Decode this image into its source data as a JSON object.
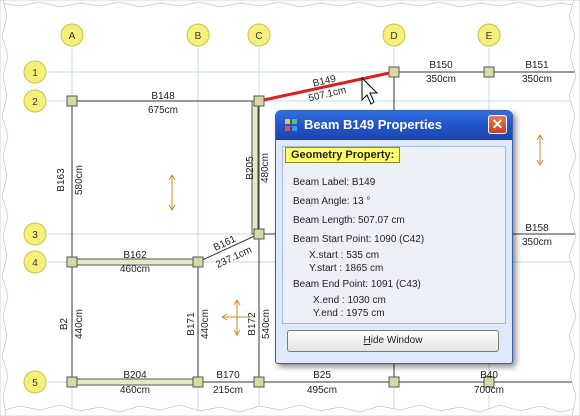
{
  "grid": {
    "columns": [
      "A",
      "B",
      "C",
      "D",
      "E"
    ],
    "rows": [
      "1",
      "2",
      "3",
      "4",
      "5"
    ]
  },
  "plan_labels": {
    "b148": "B148",
    "b148_len": "675cm",
    "b149": "B149",
    "b149_len": "507.1cm",
    "b150": "B150",
    "b150_len": "350cm",
    "b151": "B151",
    "b151_len": "350cm",
    "b163": "B163",
    "b163_len": "580cm",
    "b205": "B205",
    "b205_len": "480cm",
    "b158": "B158",
    "b158_len": "350cm",
    "b162": "B162",
    "b162_len": "460cm",
    "b161": "B161",
    "b161_len": "237.1cm",
    "b2": "B2",
    "b2_len": "440cm",
    "b171": "B171",
    "b171_len": "440cm",
    "b172": "B172",
    "b172_len": "540cm",
    "b204": "B204",
    "b204_len": "460cm",
    "b170": "B170",
    "b170_len": "215cm",
    "b25": "B25",
    "b25_len": "495cm",
    "b40": "B40",
    "b40_len": "700cm"
  },
  "dialog": {
    "title": "Beam B149 Properties",
    "close_glyph": "✕",
    "section_tab": "Geometry Property:",
    "beam_label": "Beam Label:  B149",
    "beam_angle": "Beam Angle:  13 °",
    "beam_length": "Beam Length:  507.07 cm",
    "start_point": "Beam Start Point:  1090 (C42)",
    "x_start": "X.start :   535 cm",
    "y_start": "Y.start :   1865 cm",
    "end_point": "Beam End Point:  1091 (C43)",
    "x_end": "X.end :   1030 cm",
    "y_end": "Y.end :   1975 cm",
    "hide_button_underlined": "H",
    "hide_button_rest": "ide Window"
  },
  "colors": {
    "bubble_fill": "#f5f07a",
    "bubble_stroke": "#c9c24a",
    "selected_beam": "#e02020",
    "column_fill": "#d6d9a2",
    "titlebar": "#2153c7",
    "section_tab": "#ffff66"
  }
}
